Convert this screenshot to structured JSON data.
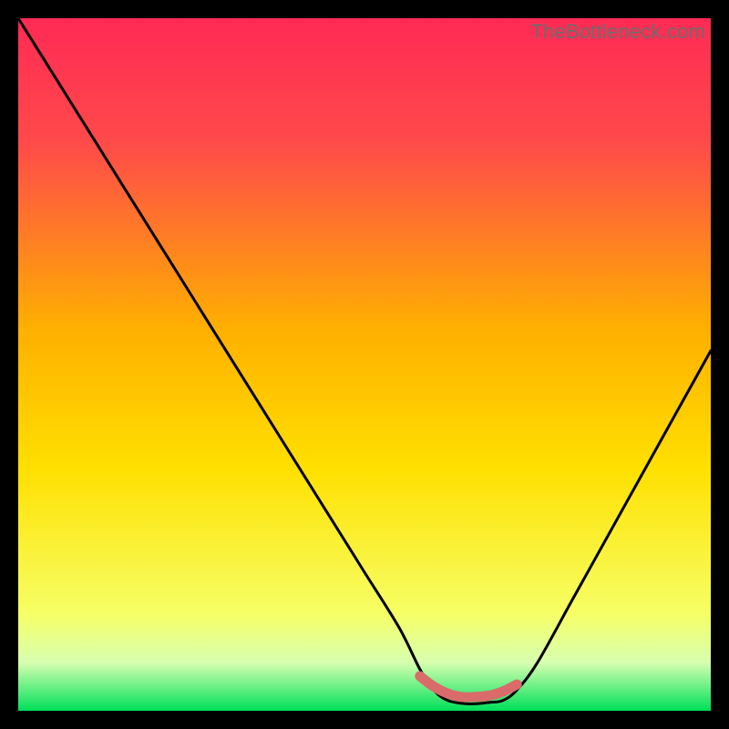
{
  "watermark": {
    "text": "TheBottleneck.com"
  },
  "chart_data": {
    "type": "line",
    "title": "",
    "xlabel": "",
    "ylabel": "",
    "xlim": [
      0,
      100
    ],
    "ylim": [
      0,
      100
    ],
    "grid": false,
    "series": [
      {
        "name": "bottleneck-curve",
        "x": [
          0,
          5,
          10,
          15,
          20,
          25,
          30,
          35,
          40,
          45,
          50,
          55,
          58,
          60,
          62,
          65,
          68,
          70,
          72,
          75,
          80,
          85,
          90,
          95,
          100
        ],
        "values": [
          100,
          92,
          84,
          76,
          68,
          60,
          52,
          44,
          36,
          28,
          20,
          12,
          6,
          3,
          1.5,
          1,
          1.2,
          1.5,
          3,
          7,
          16,
          25,
          34,
          43,
          52
        ]
      },
      {
        "name": "sweet-spot-marker",
        "x": [
          58,
          60,
          62,
          64,
          66,
          68,
          70,
          72
        ],
        "values": [
          5.0,
          3.5,
          2.5,
          2.0,
          2.0,
          2.2,
          2.8,
          3.8
        ]
      }
    ],
    "background_gradient": {
      "top_color": "#ff2a55",
      "mid_color": "#ffd400",
      "bottom_color": "#00e05a"
    },
    "marker_color": "#d96b6b",
    "curve_color": "#000000"
  }
}
